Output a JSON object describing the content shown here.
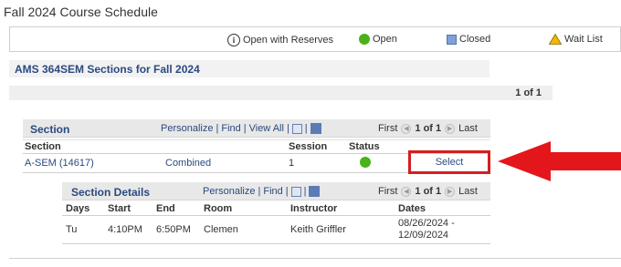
{
  "page": {
    "title": "Fall 2024 Course Schedule"
  },
  "legend": {
    "reserves": "Open with Reserves",
    "open": "Open",
    "closed": "Closed",
    "waitlist": "Wait List",
    "colors": {
      "open": "#4ab21a",
      "closed": "#7fa0d8",
      "waitlist": "#f2b600"
    }
  },
  "course": {
    "heading": "AMS 364SEM Sections for Fall 2024",
    "page_indicator": "1 of 1"
  },
  "section_grid": {
    "title": "Section",
    "tools": {
      "personalize": "Personalize",
      "find": "Find",
      "view_all": "View All"
    },
    "nav": {
      "first": "First",
      "range": "1 of 1",
      "last": "Last"
    },
    "columns": [
      "Section",
      "",
      "Session",
      "Status"
    ],
    "row": {
      "section": "A-SEM (14617)",
      "component": "Combined",
      "session": "1",
      "status": "open",
      "select": "Select"
    }
  },
  "details_grid": {
    "title": "Section Details",
    "tools": {
      "personalize": "Personalize",
      "find": "Find"
    },
    "nav": {
      "first": "First",
      "range": "1 of 1",
      "last": "Last"
    },
    "columns": [
      "Days",
      "Start",
      "End",
      "Room",
      "Instructor",
      "Dates"
    ],
    "row": {
      "days": "Tu",
      "start": "4:10PM",
      "end": "6:50PM",
      "room": "Clemen",
      "instructor": "Keith Griffler",
      "dates_line1": "08/26/2024 -",
      "dates_line2": "12/09/2024"
    }
  },
  "annotation": {
    "arrow_color": "#e3161b",
    "box_color": "#d21f1f"
  }
}
